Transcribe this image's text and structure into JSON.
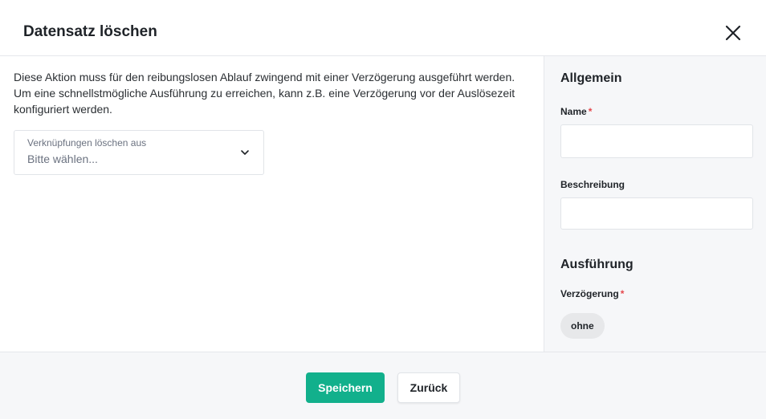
{
  "dialog": {
    "title": "Datensatz löschen",
    "close_icon": "close-icon"
  },
  "main": {
    "description_line1": "Diese Aktion muss für den reibungslosen Ablauf zwingend mit einer Verzögerung ausgeführt werden.",
    "description_line2": "Um eine schnellstmögliche Ausführung zu erreichen, kann z.B. eine Verzögerung vor der Auslösezeit",
    "description_line3": "konfiguriert werden.",
    "select": {
      "label": "Verknüpfungen löschen aus",
      "placeholder": "Bitte wählen...",
      "icon": "chevron-down-icon"
    }
  },
  "sidebar": {
    "section_general": "Allgemein",
    "name_label": "Name",
    "name_value": "",
    "description_label": "Beschreibung",
    "description_value": "",
    "section_execution": "Ausführung",
    "delay_label": "Verzögerung",
    "delay_value": "ohne",
    "required_marker": "*"
  },
  "footer": {
    "save_label": "Speichern",
    "back_label": "Zurück"
  },
  "colors": {
    "primary": "#12b08c",
    "required": "#e5484d",
    "panel_bg": "#f6f7f9"
  }
}
